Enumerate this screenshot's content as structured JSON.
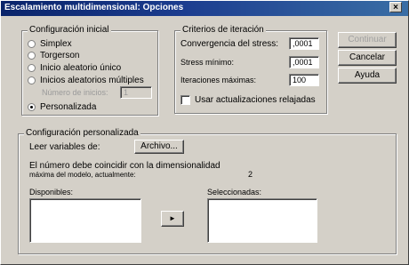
{
  "window": {
    "title": "Escalamiento multidimensional: Opciones",
    "close_glyph": "×"
  },
  "initial_config": {
    "label": "Configuración inicial",
    "options": [
      {
        "label": "Simplex",
        "checked": false,
        "enabled": true
      },
      {
        "label": "Torgerson",
        "checked": false,
        "enabled": true
      },
      {
        "label": "Inicio aleatorio único",
        "checked": false,
        "enabled": true
      },
      {
        "label": "Inicios aleatorios múltiples",
        "checked": false,
        "enabled": true
      }
    ],
    "n_starts_label": "Número de inicios:",
    "n_starts_value": "1",
    "custom_option": {
      "label": "Personalizada",
      "checked": true,
      "enabled": true
    }
  },
  "iteration_criteria": {
    "label": "Criterios de iteración",
    "stress_convergence": {
      "label": "Convergencia del stress:",
      "value": ",0001"
    },
    "min_stress": {
      "label": "Stress mínimo:",
      "value": ",0001"
    },
    "max_iterations": {
      "label": "Iteraciones máximas:",
      "value": "100"
    },
    "relaxed_updates": {
      "label": "Usar actualizaciones relajadas",
      "checked": false
    }
  },
  "buttons": {
    "continue": "Continuar",
    "cancel": "Cancelar",
    "help": "Ayuda"
  },
  "custom_config": {
    "label": "Configuración personalizada",
    "read_vars_label": "Leer variables de:",
    "file_button": "Archivo...",
    "note_line1": "El número debe coincidir con la dimensionalidad",
    "note_line2": "máxima del modelo, actualmente:",
    "dimensionality_value": "2",
    "available_label": "Disponibles:",
    "selected_label": "Seleccionadas:",
    "move_button_glyph": "►"
  },
  "icons": [
    "close-icon",
    "move-right-icon"
  ],
  "colors": {
    "title_bar_start": "#0a246a",
    "title_bar_end": "#3a6ea5",
    "dialog_background": "#d4d0c8"
  }
}
